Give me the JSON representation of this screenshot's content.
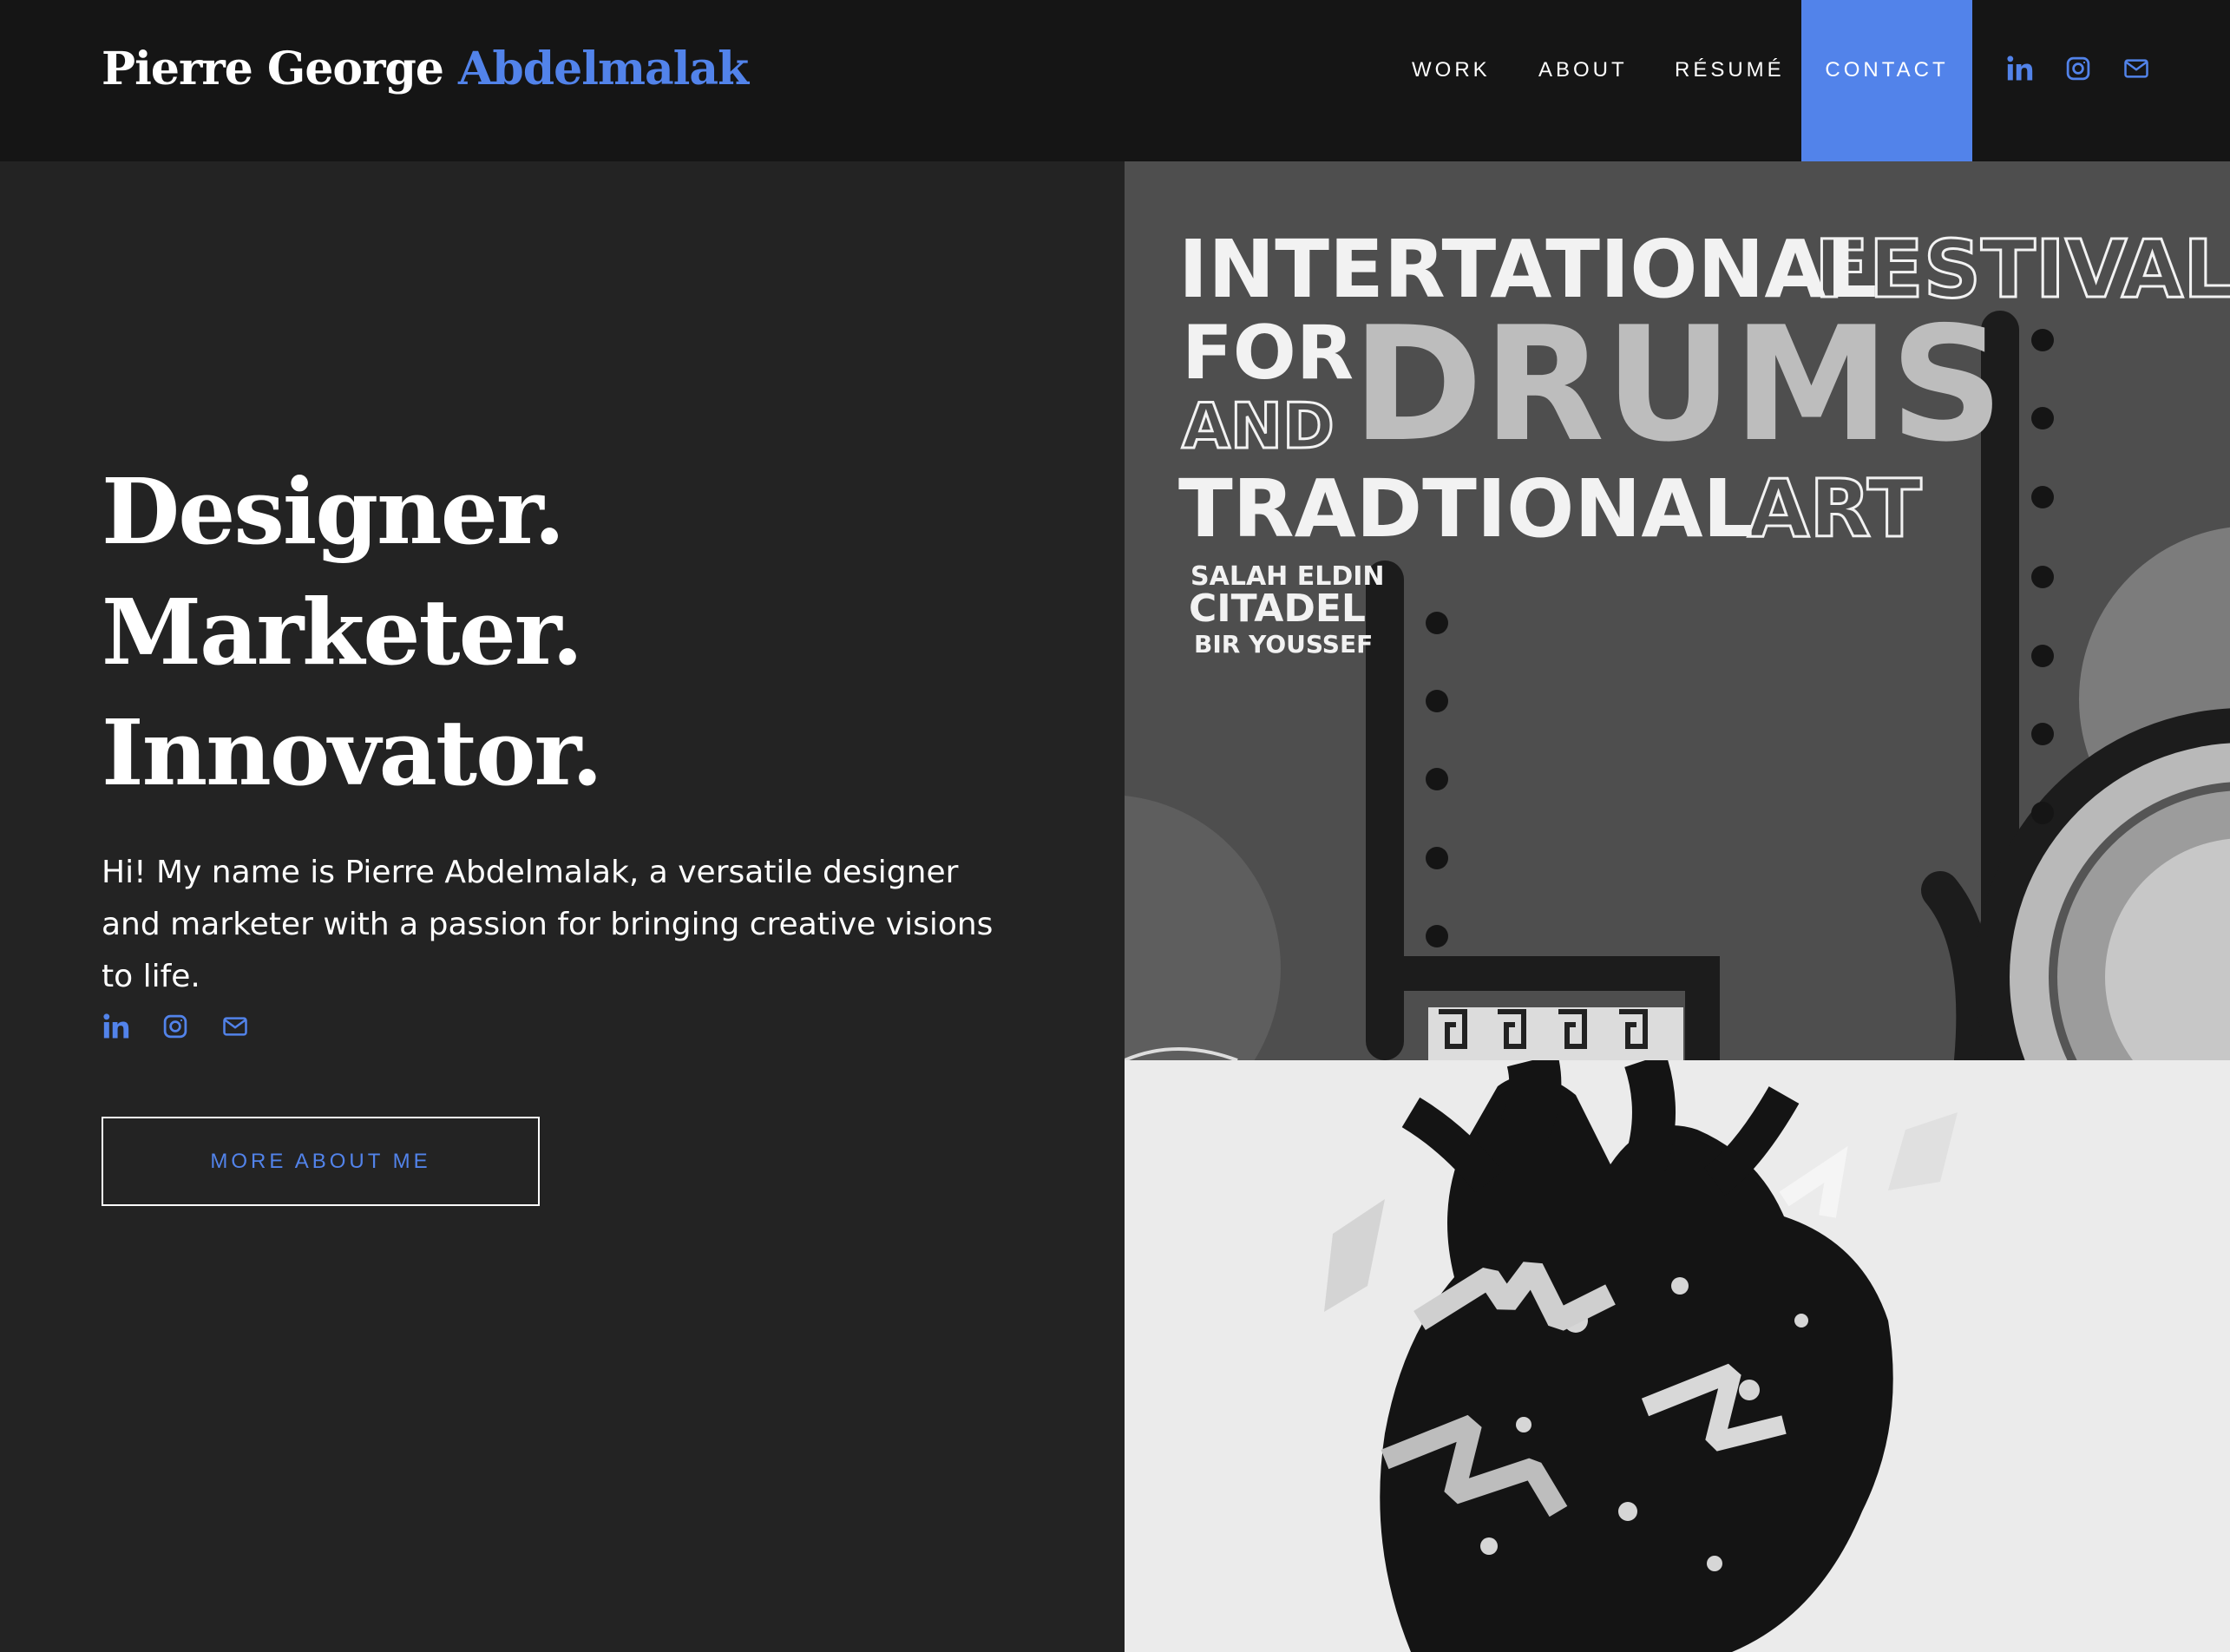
{
  "header": {
    "logo_first": "Pierre George",
    "logo_last": "Abdelmalak",
    "nav": {
      "work": "WORK",
      "about": "ABOUT",
      "resume": "RÉSUMÉ",
      "contact": "CONTACT"
    }
  },
  "hero": {
    "line1": "Designer.",
    "line2": "Marketer.",
    "line3": "Innovator.",
    "intro": "Hi! My name is Pierre Abdelmalak, a versatile designer and marketer with a passion for bringing creative visions to life.",
    "button": "MORE ABOUT ME"
  },
  "poster": {
    "line1a": "INTERTATIONAL",
    "line1b": "FESTIVAL",
    "for": "FOR",
    "and": "AND",
    "drums": "DRUMS",
    "line3a": "TRADTIONAL",
    "line3b": "ART",
    "venue1": "SALAH ELDIN",
    "venue2": "CITADEL",
    "venue3": "BIR YOUSSEF"
  },
  "colors": {
    "accent": "#5283ea",
    "header_bg": "#151515",
    "page_bg": "#232323"
  },
  "icons": [
    "linkedin-icon",
    "instagram-icon",
    "mail-icon"
  ]
}
